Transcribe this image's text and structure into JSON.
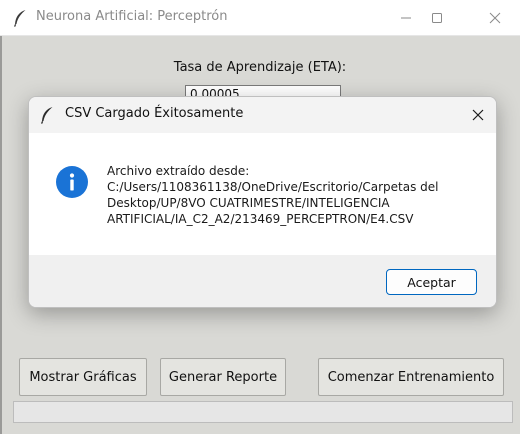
{
  "main_window": {
    "title": "Neurona Artificial: Perceptrón",
    "icon": "feather-icon",
    "controls": {
      "minimize": "minimize-icon",
      "maximize": "maximize-icon",
      "close": "close-icon"
    },
    "eta_label": "Tasa de Aprendizaje (ETA):",
    "eta_value": "0.00005",
    "buttons": {
      "graficas": "Mostrar Gráficas",
      "reporte": "Generar Reporte",
      "entrenar": "Comenzar Entrenamiento"
    },
    "progress": 0
  },
  "dialog": {
    "title": "CSV Cargado Éxitosamente",
    "icon": "info-icon",
    "message": "Archivo extraído desde:\nC:/Users/1108361138/OneDrive/Escritorio/Carpetas del\nDesktop/UP/8VO CUATRIMESTRE/INTELIGENCIA\nARTIFICIAL/IA_C2_A2/213469_PERCEPTRON/E4.CSV",
    "ok_label": "Aceptar"
  },
  "colors": {
    "info_blue": "#1a73d6",
    "button_border_focus": "#0067c0",
    "window_bg": "#d9d9d5"
  }
}
